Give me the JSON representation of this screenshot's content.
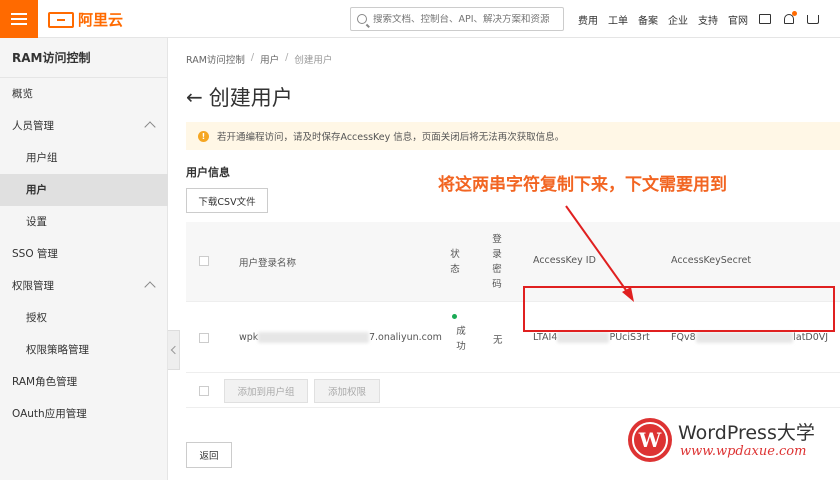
{
  "topbar": {
    "brand": "阿里云",
    "search_placeholder": "搜索文档、控制台、API、解决方案和资源",
    "nav": [
      "费用",
      "工单",
      "备案",
      "企业",
      "支持",
      "官网"
    ],
    "accent": "#ff6a00"
  },
  "sidebar": {
    "title": "RAM访问控制",
    "items": [
      {
        "label": "概览"
      },
      {
        "label": "人员管理"
      },
      {
        "label": "用户组"
      },
      {
        "label": "用户"
      },
      {
        "label": "设置"
      },
      {
        "label": "SSO 管理"
      },
      {
        "label": "权限管理"
      },
      {
        "label": "授权"
      },
      {
        "label": "权限策略管理"
      },
      {
        "label": "RAM角色管理"
      },
      {
        "label": "OAuth应用管理"
      }
    ]
  },
  "main": {
    "breadcrumb": [
      "RAM访问控制",
      "用户",
      "创建用户"
    ],
    "title": "创建用户",
    "notice": "若开通编程访问，请及时保存AccessKey 信息，页面关闭后将无法再次获取信息。",
    "section_title": "用户信息",
    "download_label": "下载CSV文件",
    "table": {
      "headers": {
        "login_name": "用户登录名称",
        "status": "状态",
        "login_password": "登录密码",
        "access_key_id": "AccessKey ID",
        "access_key_secret": "AccessKeySecret"
      },
      "row": {
        "login_prefix": "wpk",
        "login_suffix": "7.onaliyun.com",
        "status": "成功",
        "password": "无",
        "key_id_prefix": "LTAI4",
        "key_id_suffix": "PUciS3rt",
        "secret_prefix": "FQv8",
        "secret_suffix": "latD0VJ"
      }
    },
    "add_to_group_label": "添加到用户组",
    "add_permission_label": "添加权限",
    "return_label": "返回"
  },
  "annotation": "将这两串字符复制下来，下文需要用到",
  "watermark": {
    "title": "WordPress大学",
    "url": "www.wpdaxue.com"
  }
}
